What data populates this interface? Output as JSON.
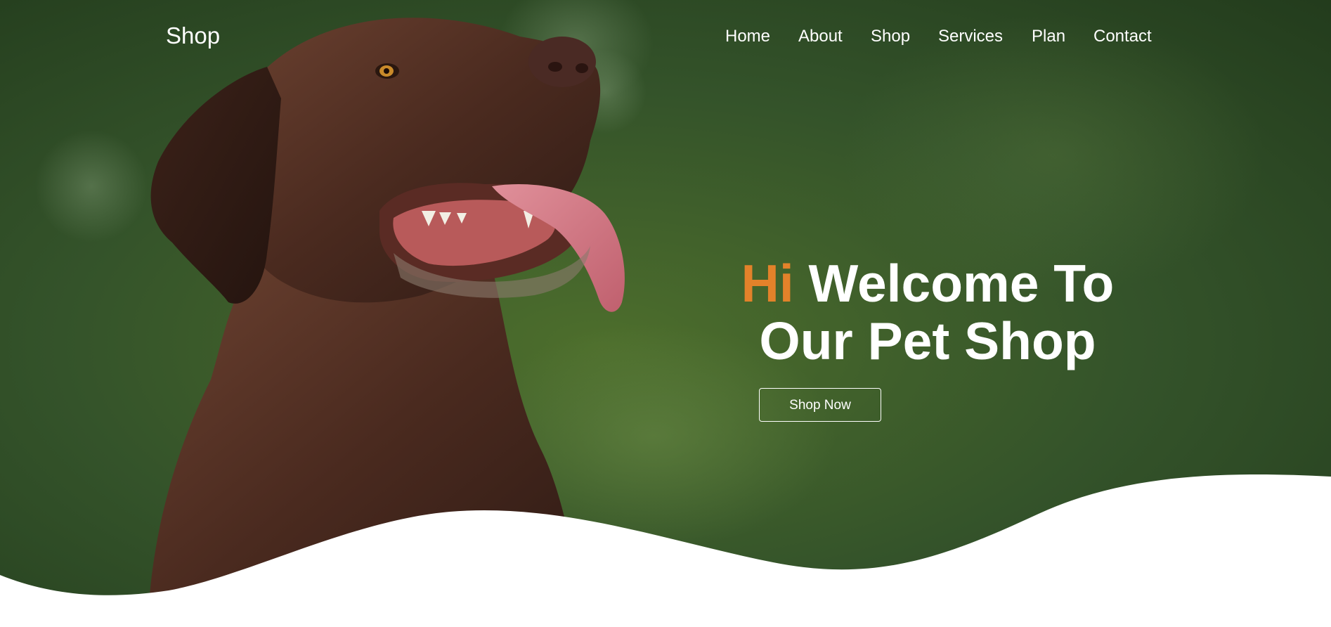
{
  "brand": {
    "logo_text": "Shop"
  },
  "nav": {
    "items": [
      {
        "label": "Home"
      },
      {
        "label": "About"
      },
      {
        "label": "Shop"
      },
      {
        "label": "Services"
      },
      {
        "label": "Plan"
      },
      {
        "label": "Contact"
      }
    ]
  },
  "hero": {
    "headline_accent": "Hi",
    "headline_line1": " Welcome To",
    "headline_line2": "Our Pet Shop",
    "cta_label": "Shop Now",
    "image": "chocolate-labrador-photo"
  },
  "colors": {
    "accent": "#e3822a",
    "text": "#ffffff",
    "background_green": "#2e4a22",
    "wave": "#ffffff"
  }
}
